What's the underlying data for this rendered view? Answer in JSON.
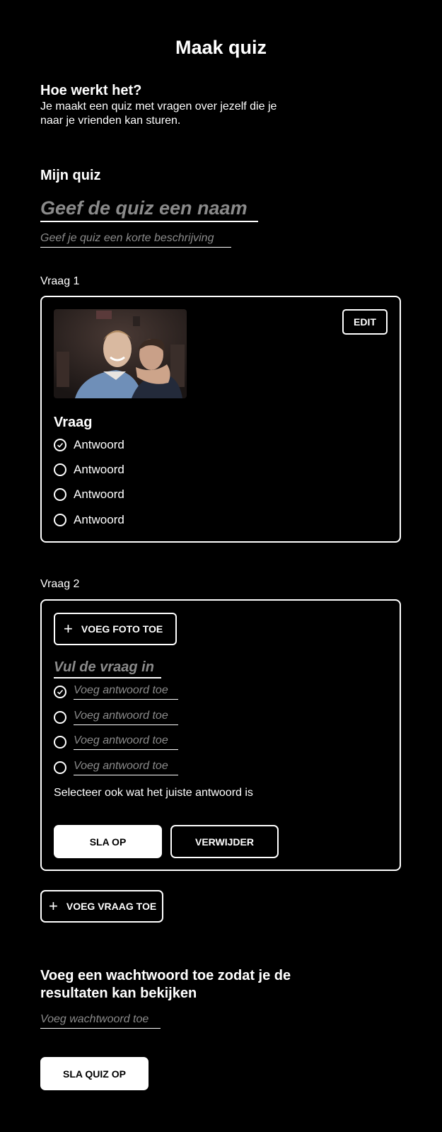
{
  "header": {
    "title": "Maak quiz"
  },
  "intro": {
    "title": "Hoe werkt het?",
    "description": "Je maakt een quiz met vragen over jezelf die je naar je vrienden kan sturen."
  },
  "my_quiz": {
    "title": "Mijn quiz",
    "name_placeholder": "Geef de quiz een naam",
    "description_placeholder": "Geef je quiz een korte beschrijving"
  },
  "question1": {
    "label": "Vraag 1",
    "edit_label": "EDIT",
    "photo": "photo of two smiling young men",
    "question": "Vraag",
    "answers": [
      {
        "text": "Antwoord",
        "correct": true
      },
      {
        "text": "Antwoord",
        "correct": false
      },
      {
        "text": "Antwoord",
        "correct": false
      },
      {
        "text": "Antwoord",
        "correct": false
      }
    ]
  },
  "question2": {
    "label": "Vraag 2",
    "add_photo_label": "VOEG FOTO TOE",
    "question_placeholder": "Vul de vraag in",
    "answer_placeholders": [
      "Voeg antwoord toe",
      "Voeg antwoord toe",
      "Voeg antwoord toe",
      "Voeg antwoord toe"
    ],
    "hint": "Selecteer ook wat het juiste antwoord is",
    "save_label": "SLA OP",
    "delete_label": "VERWIJDER"
  },
  "add_question_label": "VOEG VRAAG TOE",
  "password": {
    "title": "Voeg een wachtwoord toe zodat je de resultaten kan bekijken",
    "placeholder": "Voeg wachtwoord toe"
  },
  "save_quiz_label": "SLA QUIZ OP",
  "icons": {
    "plus": "plus-icon",
    "check": "check-circle-icon",
    "radio": "radio-empty-icon"
  },
  "colors": {
    "background": "#000000",
    "foreground": "#ffffff",
    "placeholder": "#8a8a8a"
  }
}
